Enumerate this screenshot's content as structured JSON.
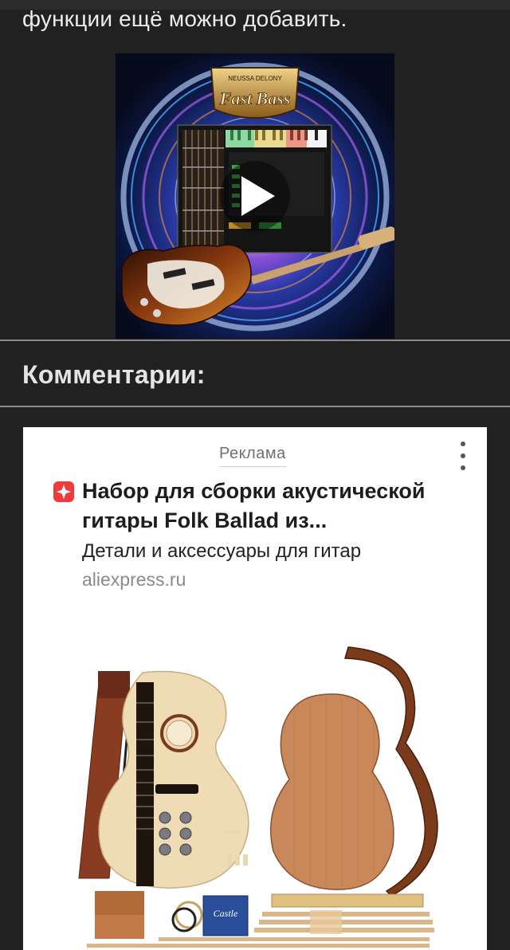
{
  "article": {
    "intro_text": "функции ещё можно добавить."
  },
  "video": {
    "product_brand": "NEUSSA DELONY",
    "product_title": "Fast Bass"
  },
  "comments": {
    "title": "Комментарии:"
  },
  "ad": {
    "label": "Реклама",
    "headline_line1": "Набор для сборки акустической",
    "headline_line2": "гитары Folk Ballad из...",
    "description": "Детали и аксессуары для гитар",
    "domain": "aliexpress.ru",
    "logo_color": "#ef3b3b",
    "strings_box_text": "Castle"
  },
  "colors": {
    "background": "#212121",
    "divider": "#8a8a8a",
    "text_primary": "#ececec",
    "ad_background": "#ffffff"
  }
}
